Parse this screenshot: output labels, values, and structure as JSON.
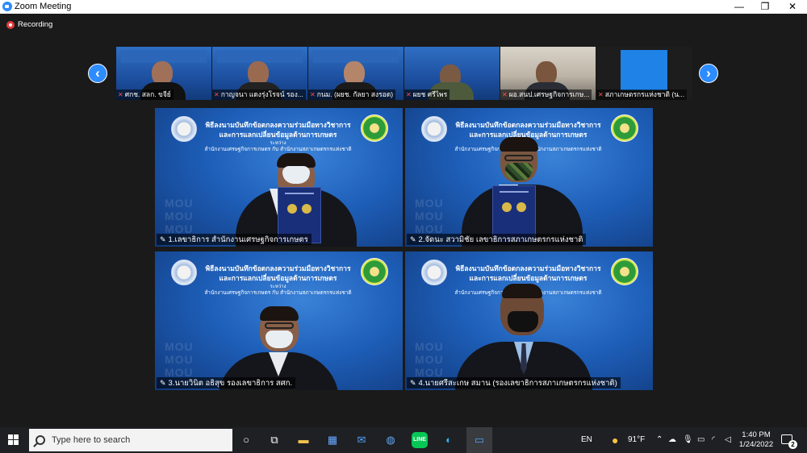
{
  "window": {
    "title": "Zoom Meeting",
    "minimize": "—",
    "maximize": "❐",
    "close": "✕"
  },
  "recording": {
    "label": "Recording"
  },
  "filmstrip": {
    "prev_arrow": "‹",
    "next_arrow": "›",
    "participants": [
      {
        "name": "ศกช. สลก. ขจีย์",
        "muted": true
      },
      {
        "name": "กาญจนา แดงรุ่งโรจน์ รอง...",
        "muted": true
      },
      {
        "name": "กนม. (ผยช. กัลยา สงรอด)",
        "muted": true
      },
      {
        "name": "ผยช ศรีไพร",
        "muted": true
      },
      {
        "name": "ผอ.สนป.เศรษฐกิจการเกษ...",
        "muted": true
      },
      {
        "name": "สภาเกษตรกรแห่งชาติ (น...",
        "muted": true
      }
    ]
  },
  "banner": {
    "line1": "พิธีลงนามบันทึกข้อตกลงความร่วมมือทางวิชาการ",
    "line2": "และการแลกเปลี่ยนข้อมูลด้านการเกษตร",
    "line3": "ระหว่าง",
    "line4": "สำนักงานเศรษฐกิจการเกษตร กับ สำนักงานสภาเกษตรกรแห่งชาติ",
    "watermark": "MOU"
  },
  "tiles": [
    {
      "name": "1.เลขาธิการ สำนักงานเศรษฐกิจการเกษตร",
      "active": true
    },
    {
      "name": "2.จัดนะ สวามิชัย เลขาธิการสภาเกษตรกรแห่งชาติ",
      "active": false
    },
    {
      "name": "3.นายวินิต อธิสุข รองเลขาธิการ สศก.",
      "active": false
    },
    {
      "name": "4.นายศรีสะเกษ สมาน (รองเลขาธิการสภาเกษตรกรแห่งชาติ)",
      "active": false
    }
  ],
  "taskbar": {
    "search_placeholder": "Type here to search",
    "language": "EN",
    "weather": "91°F",
    "time": "1:40 PM",
    "date": "1/24/2022",
    "notifications": "2"
  }
}
